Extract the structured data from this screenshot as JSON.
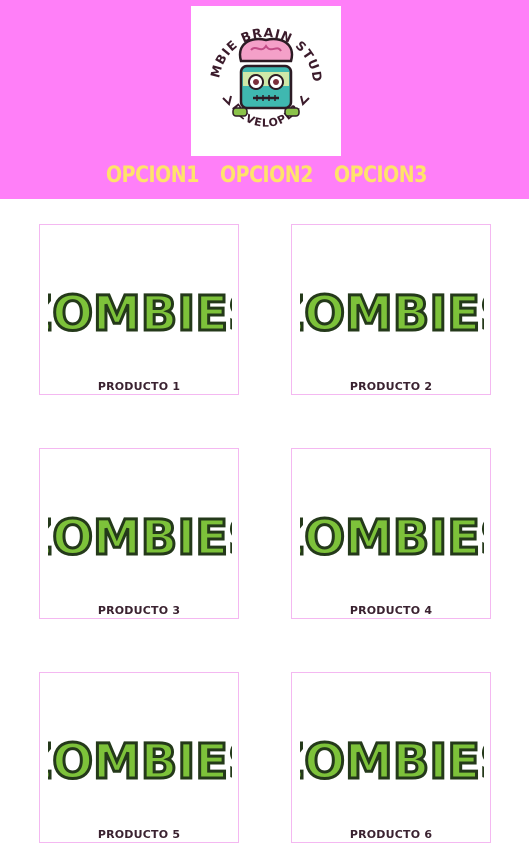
{
  "logo": {
    "ring_top_text": "ZOMBIE BRAIN STUDIO",
    "ring_bottom_text": "DEVELOPER",
    "icon": "zombie-brain-head-icon"
  },
  "nav": {
    "items": [
      {
        "label": "OPCION1"
      },
      {
        "label": "OPCION2"
      },
      {
        "label": "OPCION3"
      }
    ]
  },
  "products": [
    {
      "art_text": "ZOMBIES",
      "label": "PRODUCTO 1"
    },
    {
      "art_text": "ZOMBIES",
      "label": "PRODUCTO 2"
    },
    {
      "art_text": "ZOMBIES",
      "label": "PRODUCTO 3"
    },
    {
      "art_text": "ZOMBIES",
      "label": "PRODUCTO 4"
    },
    {
      "art_text": "ZOMBIES",
      "label": "PRODUCTO 5"
    },
    {
      "art_text": "ZOMBIES",
      "label": "PRODUCTO 6"
    }
  ],
  "colors": {
    "header_bg": "#ff7ff8",
    "nav_text": "#ffe36a",
    "card_border": "#f4b8f1",
    "zombie_green": "#7dc23a"
  }
}
